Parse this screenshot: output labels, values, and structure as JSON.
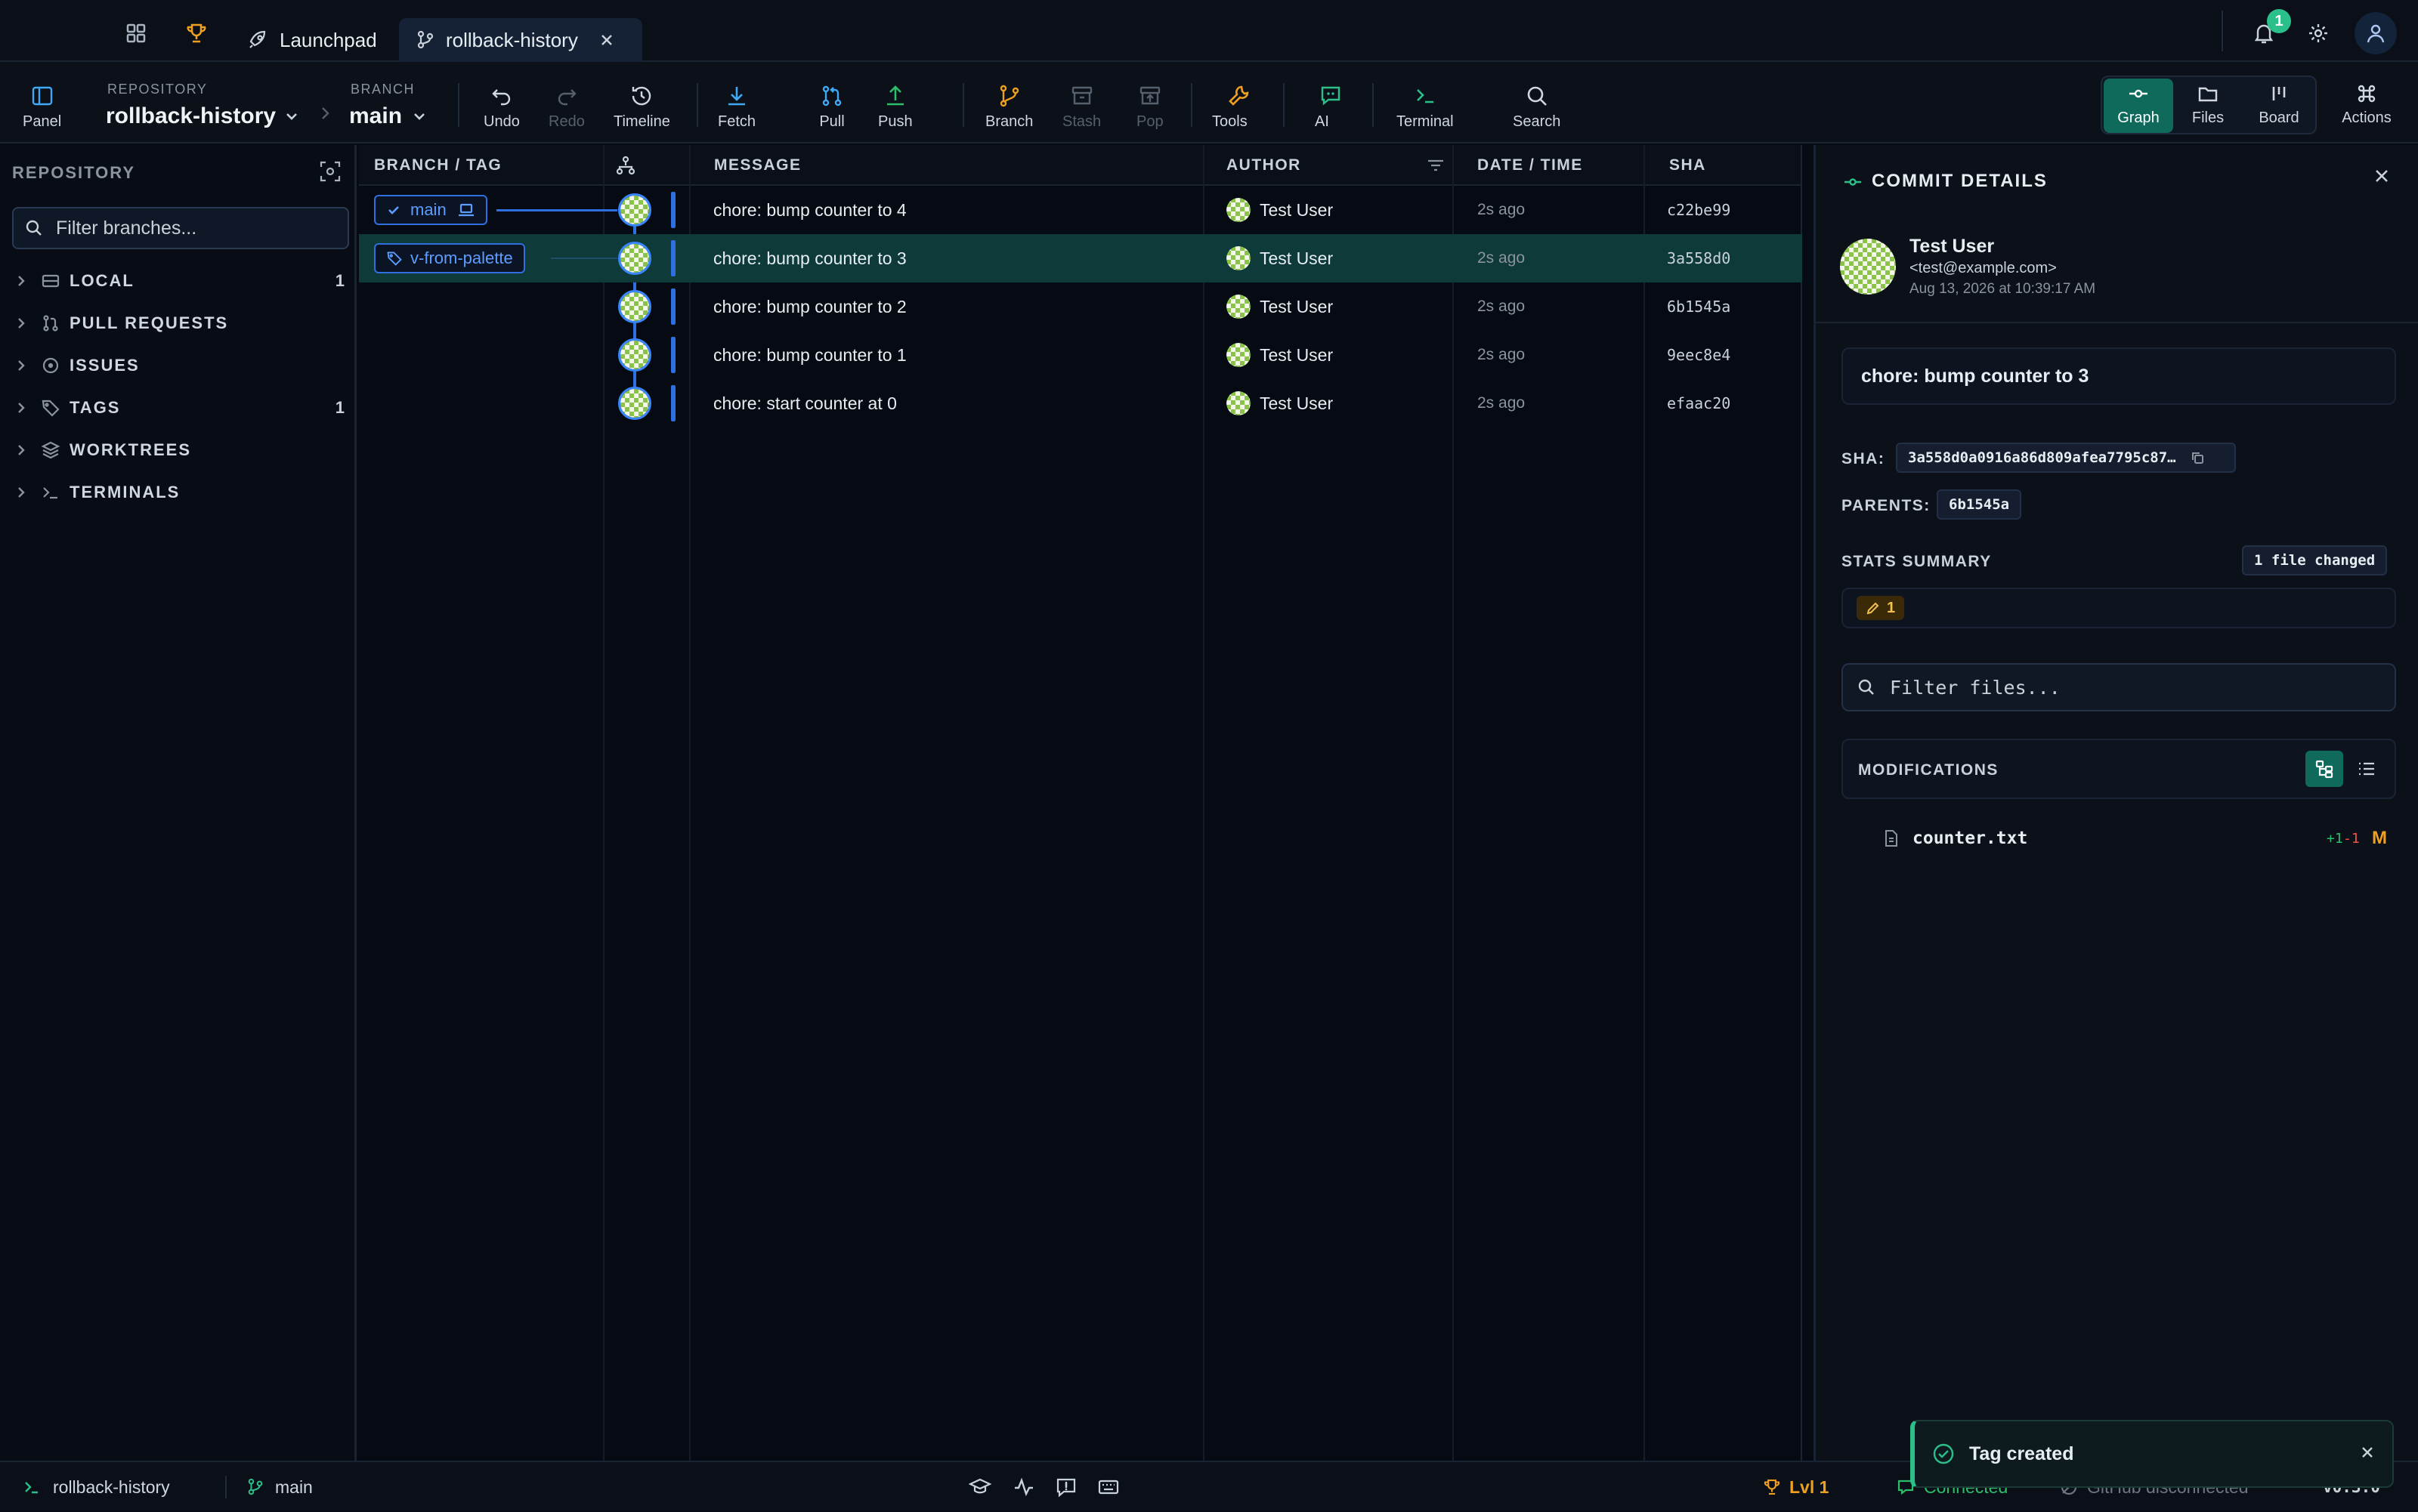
{
  "titlebar": {
    "tabs": [
      {
        "label": "Launchpad",
        "icon": "rocket-icon"
      },
      {
        "label": "rollback-history",
        "icon": "branch-icon",
        "active": true
      }
    ],
    "notification_count": "1"
  },
  "toolbar": {
    "panel_label": "Panel",
    "repository_caption": "REPOSITORY",
    "repository_name": "rollback-history",
    "branch_caption": "BRANCH",
    "branch_name": "main",
    "buttons": {
      "undo": "Undo",
      "redo": "Redo",
      "timeline": "Timeline",
      "fetch": "Fetch",
      "pull": "Pull",
      "push": "Push",
      "branch": "Branch",
      "stash": "Stash",
      "pop": "Pop",
      "tools": "Tools",
      "ai": "AI",
      "terminal": "Terminal",
      "search": "Search"
    },
    "views": {
      "graph": "Graph",
      "files": "Files",
      "board": "Board",
      "actions": "Actions"
    }
  },
  "sidebar": {
    "title": "REPOSITORY",
    "filter_placeholder": "Filter branches...",
    "sections": [
      {
        "label": "LOCAL",
        "count": "1"
      },
      {
        "label": "PULL REQUESTS",
        "count": ""
      },
      {
        "label": "ISSUES",
        "count": ""
      },
      {
        "label": "TAGS",
        "count": "1"
      },
      {
        "label": "WORKTREES",
        "count": ""
      },
      {
        "label": "TERMINALS",
        "count": ""
      }
    ]
  },
  "graph": {
    "headers": {
      "branch_tag": "BRANCH / TAG",
      "message": "MESSAGE",
      "author": "AUTHOR",
      "date_time": "DATE / TIME",
      "sha": "SHA"
    },
    "refs": {
      "branch": "main",
      "tag": "v-from-palette"
    },
    "commits": [
      {
        "message": "chore: bump counter to 4",
        "author": "Test User",
        "time": "2s ago",
        "sha": "c22be99"
      },
      {
        "message": "chore: bump counter to 3",
        "author": "Test User",
        "time": "2s ago",
        "sha": "3a558d0",
        "selected": true
      },
      {
        "message": "chore: bump counter to 2",
        "author": "Test User",
        "time": "2s ago",
        "sha": "6b1545a"
      },
      {
        "message": "chore: bump counter to 1",
        "author": "Test User",
        "time": "2s ago",
        "sha": "9eec8e4"
      },
      {
        "message": "chore: start counter at 0",
        "author": "Test User",
        "time": "2s ago",
        "sha": "efaac20"
      }
    ]
  },
  "details": {
    "title": "COMMIT DETAILS",
    "author_name": "Test User",
    "author_email": "<test@example.com>",
    "date": "Aug 13, 2026 at 10:39:17 AM",
    "message": "chore: bump counter to 3",
    "sha_label": "SHA:",
    "sha_value": "3a558d0a0916a86d809afea7795c87…",
    "parents_label": "PARENTS:",
    "parent_sha": "6b1545a",
    "stats_label": "STATS SUMMARY",
    "files_changed": "1 file changed",
    "modified_count": "1",
    "filter_files_placeholder": "Filter files...",
    "modifications_label": "MODIFICATIONS",
    "files": [
      {
        "name": "counter.txt",
        "added": "+1",
        "removed": "-1",
        "status": "M"
      }
    ]
  },
  "statusbar": {
    "repo": "rollback-history",
    "branch": "main",
    "level": "Lvl 1",
    "connection": "Connected",
    "github": "GitHub disconnected",
    "version": "v0.3.0"
  },
  "toast": {
    "message": "Tag created"
  },
  "colors": {
    "accent": "#0f6a5c",
    "graph_line": "#2f6fe0",
    "selected_row": "#0e3b3a",
    "warning": "#f0a020",
    "success": "#2bbf8a"
  }
}
